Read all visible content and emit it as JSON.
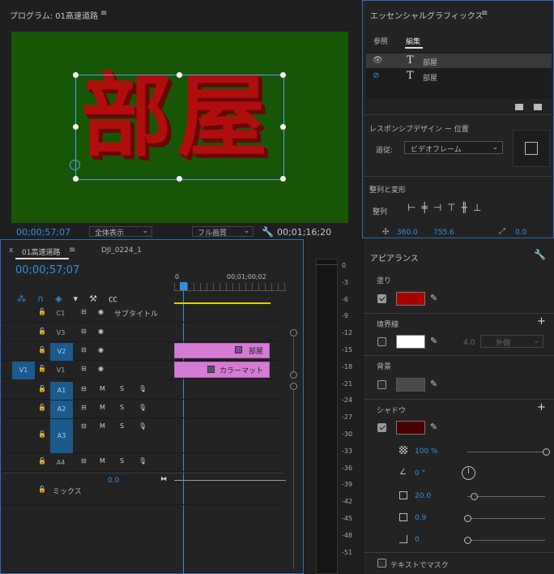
{
  "program": {
    "title": "プログラム: 01高速道路",
    "canvas_text": "部屋",
    "timecode": "00;00;57;07",
    "zoom": "全体表示",
    "quality": "フル画質",
    "duration": "00;01;16;20"
  },
  "essential_graphics": {
    "title": "エッセンシャルグラフィックス",
    "tabs": [
      "参照",
      "編集"
    ],
    "active_tab": "編集",
    "layers": [
      {
        "name": "部屋",
        "visible": true
      },
      {
        "name": "部屋",
        "visible": false
      }
    ],
    "responsive_label": "レスポンシブデザイン ー 位置",
    "follow_label": "追従:",
    "follow_value": "ビデオフレーム",
    "align_section": "整列と変形",
    "align_label": "整列",
    "pos_x": "360.0",
    "pos_y": "755.6",
    "rotation": "0.0"
  },
  "timeline": {
    "tab_close": "x",
    "tab_active": "01高速道路",
    "tab_other": "DJI_0224_1",
    "timecode": "00;00;57;07",
    "ruler_start": "0",
    "ruler_mark": "00;01;00;02",
    "tracks": [
      {
        "id": "C1",
        "label": "サブタイトル",
        "type": "caption"
      },
      {
        "id": "V3",
        "type": "video"
      },
      {
        "id": "V2",
        "type": "video",
        "target": true
      },
      {
        "id": "V1",
        "type": "video",
        "target": true,
        "source": "V1"
      },
      {
        "id": "A1",
        "type": "audio",
        "target": true
      },
      {
        "id": "A2",
        "type": "audio",
        "target": true
      },
      {
        "id": "A3",
        "type": "audio",
        "target": true
      },
      {
        "id": "A4",
        "type": "audio"
      }
    ],
    "audio_m": "M",
    "audio_s": "S",
    "mix_label": "ミックス",
    "mix_value": "0.0",
    "clips": [
      {
        "track": "V2",
        "label": "部屋"
      },
      {
        "track": "V1",
        "label": "カラーマット"
      }
    ]
  },
  "meter": {
    "ticks": [
      "0",
      "-3",
      "-6",
      "-9",
      "-12",
      "-15",
      "-18",
      "-21",
      "-24",
      "-27",
      "-30",
      "-33",
      "-36",
      "-39",
      "-42",
      "-45",
      "-48",
      "-51"
    ]
  },
  "appearance": {
    "title": "アピアランス",
    "fill_label": "塗り",
    "fill_color": "#a80000",
    "stroke_label": "境界線",
    "stroke_color": "#ffffff",
    "stroke_width": "4.0",
    "stroke_type": "外側",
    "background_label": "背景",
    "background_color": "#4a4a4a",
    "shadow_label": "シャドウ",
    "shadow_color": "#4a0000",
    "opacity": "100 %",
    "angle": "0 °",
    "distance": "20.0",
    "size": "0.9",
    "blur": "0",
    "mask_label": "テキストでマスク"
  }
}
